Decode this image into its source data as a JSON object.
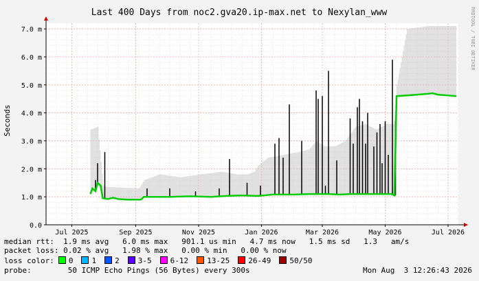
{
  "chart_data": {
    "type": "line",
    "title": "Last 400 Days from noc2.gva20.ip-max.net to Nexylan_www",
    "ylabel": "Seconds",
    "side_label": "RRDTOOL / TOBI OETIKER",
    "ylim": [
      0,
      7.2
    ],
    "y_ticks": [
      {
        "v": 0,
        "label": "0.0"
      },
      {
        "v": 1,
        "label": "1.0 m"
      },
      {
        "v": 2,
        "label": "2.0 m"
      },
      {
        "v": 3,
        "label": "3.0 m"
      },
      {
        "v": 4,
        "label": "4.0 m"
      },
      {
        "v": 5,
        "label": "5.0 m"
      },
      {
        "v": 6,
        "label": "6.0 m"
      },
      {
        "v": 7,
        "label": "7.0 m"
      }
    ],
    "x_range": [
      0,
      400
    ],
    "x_ticks": [
      {
        "d": 25,
        "label": "Jul 2025"
      },
      {
        "d": 87,
        "label": "Sep 2025"
      },
      {
        "d": 148,
        "label": "Nov 2025"
      },
      {
        "d": 209,
        "label": "Jan 2026"
      },
      {
        "d": 268,
        "label": "Mar 2026"
      },
      {
        "d": 329,
        "label": "May 2026"
      },
      {
        "d": 390,
        "label": "Jul 2026"
      }
    ],
    "grid": true,
    "median_rtt_ms": [
      [
        43,
        1.1
      ],
      [
        45,
        1.3
      ],
      [
        48,
        1.2
      ],
      [
        50,
        1.5
      ],
      [
        53,
        1.4
      ],
      [
        55,
        0.95
      ],
      [
        60,
        0.92
      ],
      [
        65,
        0.97
      ],
      [
        70,
        0.92
      ],
      [
        78,
        0.9
      ],
      [
        85,
        0.9
      ],
      [
        92,
        0.9
      ],
      [
        95,
        1.0
      ],
      [
        105,
        1.0
      ],
      [
        120,
        1.0
      ],
      [
        140,
        1.02
      ],
      [
        160,
        1.0
      ],
      [
        175,
        1.03
      ],
      [
        190,
        1.05
      ],
      [
        205,
        1.03
      ],
      [
        220,
        1.08
      ],
      [
        240,
        1.08
      ],
      [
        255,
        1.1
      ],
      [
        265,
        1.1
      ],
      [
        275,
        1.1
      ],
      [
        285,
        1.08
      ],
      [
        295,
        1.1
      ],
      [
        310,
        1.1
      ],
      [
        325,
        1.1
      ],
      [
        335,
        1.1
      ],
      [
        338,
        1.05
      ],
      [
        340,
        4.6
      ],
      [
        350,
        4.62
      ],
      [
        360,
        4.65
      ],
      [
        370,
        4.68
      ],
      [
        375,
        4.7
      ],
      [
        380,
        4.65
      ],
      [
        390,
        4.62
      ],
      [
        398,
        4.6
      ]
    ],
    "spikes_ms": [
      [
        48,
        1.6
      ],
      [
        50,
        2.2
      ],
      [
        57,
        2.6
      ],
      [
        98,
        1.3
      ],
      [
        120,
        1.3
      ],
      [
        145,
        1.2
      ],
      [
        168,
        1.3
      ],
      [
        178,
        2.35
      ],
      [
        195,
        1.5
      ],
      [
        208,
        1.4
      ],
      [
        222,
        2.9
      ],
      [
        226,
        3.1
      ],
      [
        230,
        2.4
      ],
      [
        236,
        4.3
      ],
      [
        248,
        3.0
      ],
      [
        262,
        4.8
      ],
      [
        264,
        4.5
      ],
      [
        268,
        4.6
      ],
      [
        271,
        1.4
      ],
      [
        274,
        5.5
      ],
      [
        282,
        2.3
      ],
      [
        295,
        3.8
      ],
      [
        298,
        2.9
      ],
      [
        302,
        4.2
      ],
      [
        304,
        4.5
      ],
      [
        307,
        3.7
      ],
      [
        310,
        2.9
      ],
      [
        312,
        4.0
      ],
      [
        318,
        2.8
      ],
      [
        321,
        3.3
      ],
      [
        324,
        3.6
      ],
      [
        326,
        2.2
      ],
      [
        329,
        3.7
      ],
      [
        332,
        2.5
      ],
      [
        336,
        5.9
      ],
      [
        339,
        3.7
      ]
    ],
    "noise_band_ms": [
      [
        43,
        1.1,
        3.4
      ],
      [
        50,
        1.4,
        3.5
      ],
      [
        55,
        0.95,
        1.4
      ],
      [
        60,
        0.92,
        1.35
      ],
      [
        90,
        0.9,
        1.3
      ],
      [
        95,
        1.0,
        1.6
      ],
      [
        110,
        1.0,
        1.8
      ],
      [
        130,
        1.0,
        1.7
      ],
      [
        150,
        1.0,
        1.8
      ],
      [
        170,
        1.0,
        1.9
      ],
      [
        185,
        1.05,
        1.8
      ],
      [
        195,
        1.05,
        1.8
      ],
      [
        202,
        1.03,
        1.9
      ],
      [
        205,
        1.03,
        2.1
      ],
      [
        215,
        1.05,
        2.4
      ],
      [
        230,
        1.08,
        2.5
      ],
      [
        245,
        1.08,
        2.6
      ],
      [
        255,
        1.1,
        2.7
      ],
      [
        262,
        1.1,
        3.0
      ],
      [
        270,
        1.1,
        2.8
      ],
      [
        280,
        1.08,
        2.8
      ],
      [
        290,
        1.1,
        3.0
      ],
      [
        300,
        1.1,
        3.5
      ],
      [
        310,
        1.1,
        3.6
      ],
      [
        320,
        1.1,
        3.4
      ],
      [
        330,
        1.1,
        3.6
      ],
      [
        337,
        1.1,
        3.6
      ],
      [
        340,
        4.6,
        5.0
      ],
      [
        345,
        4.62,
        6.0
      ],
      [
        350,
        4.62,
        7.0
      ],
      [
        370,
        4.68,
        7.1
      ],
      [
        390,
        4.62,
        7.1
      ],
      [
        398,
        4.6,
        7.1
      ]
    ],
    "colors": {
      "canvas": "#ffffff",
      "back": "#f3f3f3",
      "grid_minor": "#e8e0e0",
      "grid_major": "#f2b8b8",
      "axis": "#000000",
      "arrow": "#cc0000",
      "rtt": "#00cc00",
      "smoke": "#c8c8c8"
    }
  },
  "stats": {
    "median_rtt": "median rtt:  1.9 ms avg   6.0 ms max   901.1 us min   4.7 ms now   1.5 ms sd   1.3   am/s",
    "packet_loss": "packet loss: 0.02 % avg   1.98 % max   0.00 % min   0.00 % now",
    "loss_color_label": "loss color:",
    "probe": "probe:        50 ICMP Echo Pings (56 Bytes) every 300s",
    "timestamp": "Mon Aug  3 12:26:43 2026"
  },
  "loss_legend": [
    {
      "label": "0",
      "color": "#00ff00"
    },
    {
      "label": "1",
      "color": "#00b8ff"
    },
    {
      "label": "2",
      "color": "#0059ff"
    },
    {
      "label": "3-5",
      "color": "#5e00ff"
    },
    {
      "label": "6-12",
      "color": "#ff00ff"
    },
    {
      "label": "13-25",
      "color": "#ff5500"
    },
    {
      "label": "26-49",
      "color": "#ff0000"
    },
    {
      "label": "50/50",
      "color": "#a10000"
    }
  ]
}
